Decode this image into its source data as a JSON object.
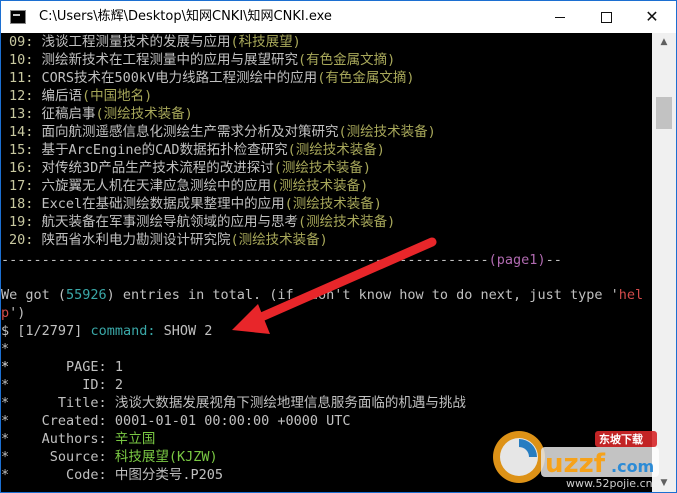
{
  "window": {
    "title": "C:\\Users\\栋辉\\Desktop\\知网CNKI\\知网CNKI.exe",
    "minimize_glyph": "—",
    "maximize_glyph": "☐",
    "close_glyph": "✕"
  },
  "entries": [
    {
      "num": "09:",
      "title": "浅谈工程测量技术的发展与应用",
      "source": "(科技展望)"
    },
    {
      "num": "10:",
      "title": "测绘新技术在工程测量中的应用与展望研究",
      "source": "(有色金属文摘)"
    },
    {
      "num": "11:",
      "title": "CORS技术在500kV电力线路工程测绘中的应用",
      "source": "(有色金属文摘)"
    },
    {
      "num": "12:",
      "title": "编后语",
      "source": "(中国地名)"
    },
    {
      "num": "13:",
      "title": "征稿启事",
      "source": "(测绘技术装备)"
    },
    {
      "num": "14:",
      "title": "面向航测遥感信息化测绘生产需求分析及对策研究",
      "source": "(测绘技术装备)"
    },
    {
      "num": "15:",
      "title": "基于ArcEngine的CAD数据拓扑检查研究",
      "source": "(测绘技术装备)"
    },
    {
      "num": "16:",
      "title": "对传统3D产品生产技术流程的改进探讨",
      "source": "(测绘技术装备)"
    },
    {
      "num": "17:",
      "title": "六旋翼无人机在天津应急测绘中的应用",
      "source": "(测绘技术装备)"
    },
    {
      "num": "18:",
      "title": "Excel在基础测绘数据成果整理中的应用",
      "source": "(测绘技术装备)"
    },
    {
      "num": "19:",
      "title": "航天装备在军事测绘导航领域的应用与思考",
      "source": "(测绘技术装备)"
    },
    {
      "num": "20:",
      "title": "陕西省水利电力勘测设计研究院",
      "source": "(测绘技术装备)"
    }
  ],
  "separator": {
    "dashes_left": "------------------------------------------------------------",
    "page_label": "(page1)",
    "dashes_right": "--"
  },
  "summary": {
    "prefix": "We got (",
    "count": "55926",
    "middle": ") entries in total. (if  don't know how to do next, just type '",
    "hint_a": "hel",
    "hint_b": "p",
    "suffix": "')"
  },
  "prompt": {
    "dollar": "$",
    "position": "[1/2797]",
    "label": "command:",
    "command": "SHOW 2"
  },
  "detail": {
    "blank_star": "*",
    "fields": [
      {
        "label": "PAGE:",
        "value": "1",
        "color": "plain"
      },
      {
        "label": "ID:",
        "value": "2",
        "color": "plain"
      },
      {
        "label": "Title:",
        "value": "浅谈大数据发展视角下测绘地理信息服务面临的机遇与挑战",
        "color": "plain"
      },
      {
        "label": "Created:",
        "value": "0001-01-01 00:00:00 +0000 UTC",
        "color": "plain"
      },
      {
        "label": "Authors:",
        "value": "辛立国",
        "color": "green"
      },
      {
        "label": "Source:",
        "value": "科技展望(KJZW)",
        "color": "green"
      },
      {
        "label": "Code:",
        "value": "中图分类号.P205",
        "color": "plain"
      }
    ]
  },
  "watermark": {
    "brand": "uzzf",
    "tag": "东坡下载",
    "domain": ".com",
    "site": "www.52pojie.cn"
  },
  "colors": {
    "accent_arrow": "#e8262a",
    "source_text": "#a8a85a",
    "author_green": "#7ac943",
    "number_cyan": "#3aa8a8",
    "page_purple": "#b06ab0"
  }
}
